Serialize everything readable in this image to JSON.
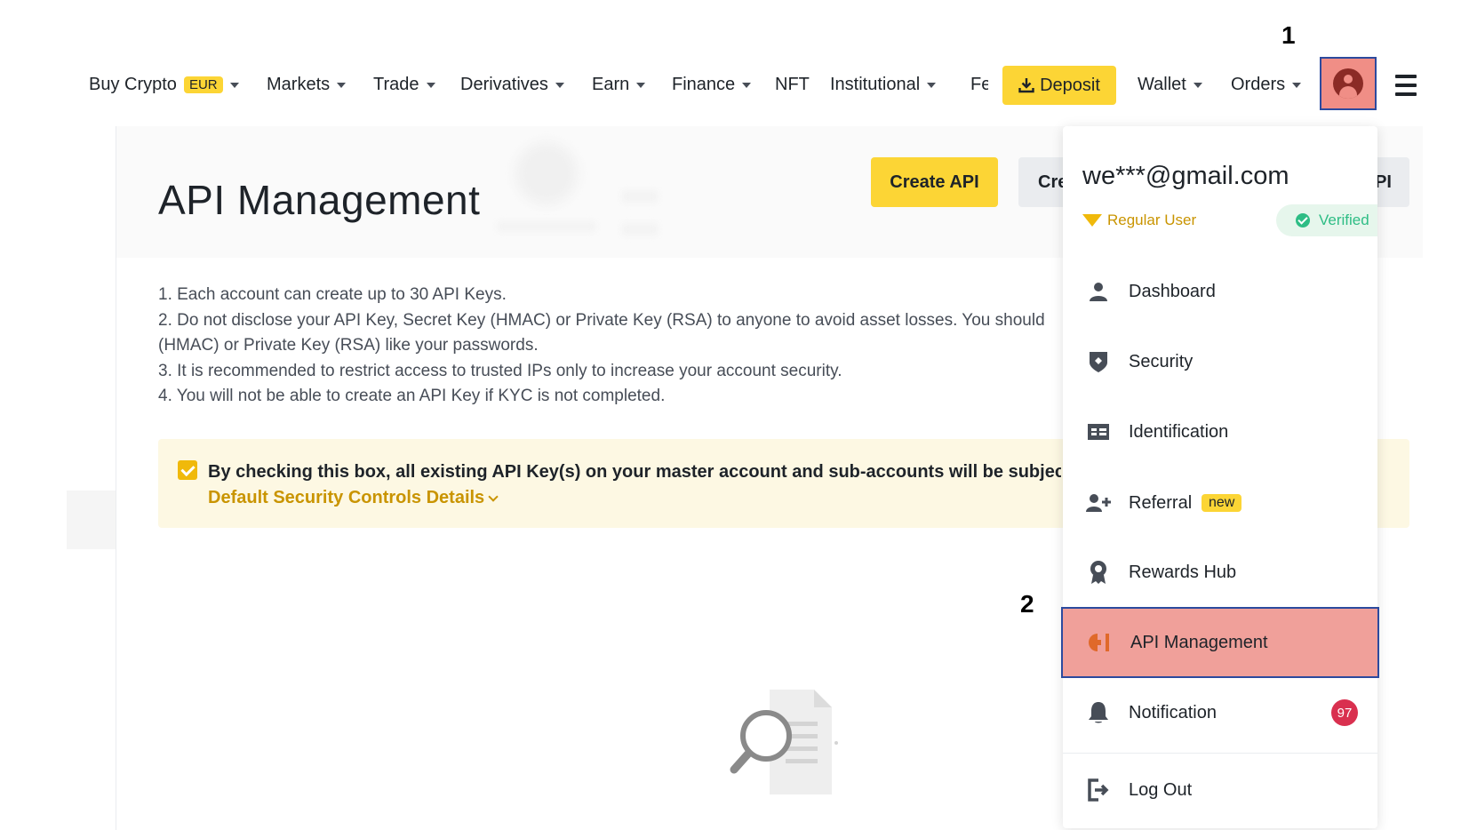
{
  "nav": {
    "items": [
      {
        "label": "Buy Crypto",
        "badge": "EUR"
      },
      {
        "label": "Markets"
      },
      {
        "label": "Trade"
      },
      {
        "label": "Derivatives"
      },
      {
        "label": "Earn"
      },
      {
        "label": "Finance"
      },
      {
        "label": "NFT"
      },
      {
        "label": "Institutional"
      },
      {
        "label": "Fe"
      }
    ],
    "deposit_label": "Deposit",
    "wallet_label": "Wallet",
    "orders_label": "Orders",
    "brand_yellow": "#fcd535",
    "avatar_highlight": "#f08e86"
  },
  "annotations": {
    "step1": "1",
    "step2": "2"
  },
  "page": {
    "title": "API Management",
    "create_api_label": "Create API",
    "create_api2_label": "Cre",
    "create_api2_tail": "PI",
    "notes": [
      "1. Each account can create up to 30 API Keys.",
      "2. Do not disclose your API Key, Secret Key (HMAC) or Private Key (RSA) to anyone to avoid asset losses. You should",
      "(HMAC) or Private Key (RSA) like your passwords.",
      "3. It is recommended to restrict access to trusted IPs only to increase your account security.",
      "4. You will not be able to create an API Key if KYC is not completed."
    ],
    "checkbox_text": "By checking this box, all existing API Key(s) on your master account and sub-accounts will be subject to De",
    "details_link": "Default Security Controls Details"
  },
  "dropdown": {
    "email": "we***@gmail.com",
    "user_tier": "Regular User",
    "verified_label": "Verified",
    "items": [
      {
        "label": "Dashboard",
        "icon": "user-icon"
      },
      {
        "label": "Security",
        "icon": "shield-icon"
      },
      {
        "label": "Identification",
        "icon": "id-card-icon"
      },
      {
        "label": "Referral",
        "icon": "add-user-icon",
        "badge": "new"
      },
      {
        "label": "Rewards Hub",
        "icon": "medal-icon"
      },
      {
        "label": "API Management",
        "icon": "api-icon",
        "highlighted": true
      },
      {
        "label": "Notification",
        "icon": "bell-icon",
        "count": "97"
      },
      {
        "label": "Log Out",
        "icon": "logout-icon"
      }
    ]
  }
}
